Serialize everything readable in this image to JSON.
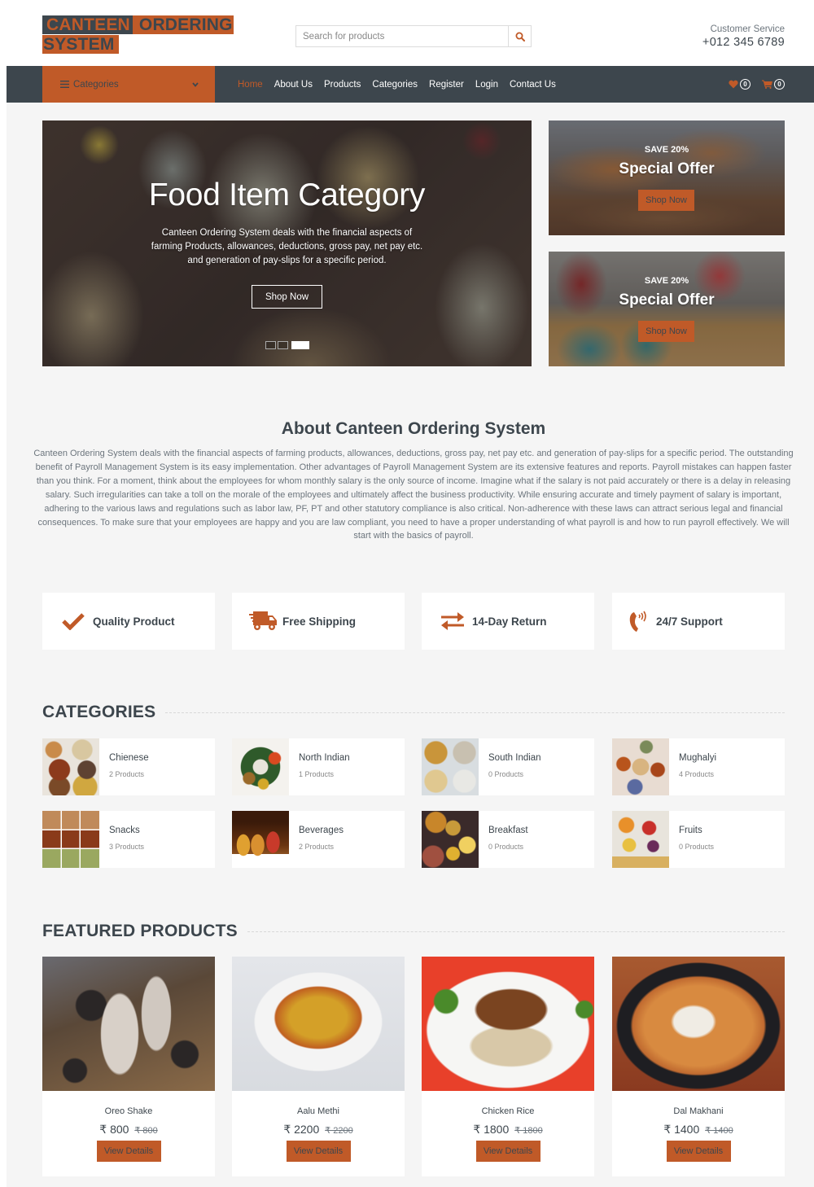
{
  "header": {
    "logo_words": [
      "CANTEEN",
      "ORDERING",
      "SYSTEM"
    ],
    "search_placeholder": "Search for products",
    "search_value": "",
    "customer_service_label": "Customer Service",
    "phone": "+012 345 6789"
  },
  "nav": {
    "categories_label": "Categories",
    "items": [
      {
        "label": "Home",
        "active": true
      },
      {
        "label": "About Us",
        "active": false
      },
      {
        "label": "Products",
        "active": false
      },
      {
        "label": "Categories",
        "active": false
      },
      {
        "label": "Register",
        "active": false
      },
      {
        "label": "Login",
        "active": false
      },
      {
        "label": "Contact Us",
        "active": false
      }
    ],
    "wishlist_count": "0",
    "cart_count": "0"
  },
  "hero": {
    "title": "Food Item Category",
    "text": "Canteen Ordering System deals with the financial aspects of farming Products, allowances, deductions, gross pay, net pay etc. and generation of pay-slips for a specific period.",
    "button": "Shop Now",
    "slides": 3,
    "active_slide": 3
  },
  "offers": [
    {
      "save": "SAVE 20%",
      "title": "Special Offer",
      "button": "Shop Now"
    },
    {
      "save": "SAVE 20%",
      "title": "Special Offer",
      "button": "Shop Now"
    }
  ],
  "about": {
    "title": "About Canteen Ordering System",
    "text": "Canteen Ordering System deals with the financial aspects of farming products, allowances, deductions, gross pay, net pay etc. and generation of pay-slips for a specific period. The outstanding benefit of Payroll Management System is its easy implementation. Other advantages of Payroll Management System are its extensive features and reports. Payroll mistakes can happen faster than you think. For a moment, think about the employees for whom monthly salary is the only source of income. Imagine what if the salary is not paid accurately or there is a delay in releasing salary. Such irregularities can take a toll on the morale of the employees and ultimately affect the business productivity. While ensuring accurate and timely payment of salary is important, adhering to the various laws and regulations such as labor law, PF, PT and other statutory compliance is also critical. Non-adherence with these laws can attract serious legal and financial consequences. To make sure that your employees are happy and you are law compliant, you need to have a proper understanding of what payroll is and how to run payroll effectively. We will start with the basics of payroll."
  },
  "features": [
    {
      "icon": "check-icon",
      "label": "Quality Product"
    },
    {
      "icon": "truck-icon",
      "label": "Free Shipping"
    },
    {
      "icon": "exchange-icon",
      "label": "14-Day Return"
    },
    {
      "icon": "phone-icon",
      "label": "24/7 Support"
    }
  ],
  "categories": {
    "title": "CATEGORIES",
    "items": [
      {
        "name": "Chienese",
        "count": "2 Products"
      },
      {
        "name": "North Indian",
        "count": "1 Products"
      },
      {
        "name": "South Indian",
        "count": "0 Products"
      },
      {
        "name": "Mughalyi",
        "count": "4 Products"
      },
      {
        "name": "Snacks",
        "count": "3 Products"
      },
      {
        "name": "Beverages",
        "count": "2 Products"
      },
      {
        "name": "Breakfast",
        "count": "0 Products"
      },
      {
        "name": "Fruits",
        "count": "0 Products"
      }
    ]
  },
  "featured": {
    "title": "FEATURED PRODUCTS",
    "button": "View Details",
    "items": [
      {
        "name": "Oreo Shake",
        "price": "₹ 800",
        "old_price": "₹ 800"
      },
      {
        "name": "Aalu Methi",
        "price": "₹ 2200",
        "old_price": "₹ 2200"
      },
      {
        "name": "Chicken Rice",
        "price": "₹ 1800",
        "old_price": "₹ 1800"
      },
      {
        "name": "Dal Makhani",
        "price": "₹ 1400",
        "old_price": "₹ 1400"
      }
    ]
  },
  "colors": {
    "accent": "#c05a28",
    "dark": "#3d464d",
    "background": "#f5f5f5"
  }
}
